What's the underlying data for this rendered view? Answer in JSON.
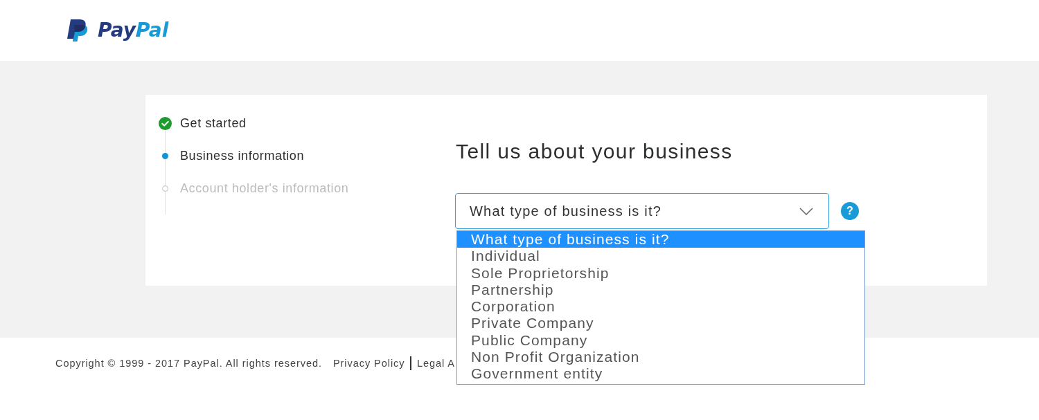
{
  "header": {
    "logo": {
      "text": "PayPal"
    }
  },
  "stepper": {
    "steps": [
      {
        "label": "Get started",
        "completed": true
      },
      {
        "label": "Business information",
        "completed": false
      },
      {
        "label": "Account holder's information",
        "completed": false
      }
    ]
  },
  "form": {
    "heading": "Tell us about your business",
    "business_type": {
      "value": "What type of business is it?",
      "expanded": true,
      "options": [
        {
          "label": "What type of business is it?",
          "selected": true
        },
        {
          "label": "Individual",
          "selected": false
        },
        {
          "label": "Sole Proprietorship",
          "selected": false
        },
        {
          "label": "Partnership",
          "selected": false
        },
        {
          "label": "Corporation",
          "selected": false
        },
        {
          "label": "Private Company",
          "selected": false
        },
        {
          "label": "Public Company",
          "selected": false
        },
        {
          "label": "Non Profit Organization",
          "selected": false
        },
        {
          "label": "Government entity",
          "selected": false
        }
      ]
    },
    "help": {
      "label": "?"
    }
  },
  "footer": {
    "copyright": "Copyright © 1999 - 2017 PayPal. All rights reserved.",
    "links": [
      "Privacy Policy",
      "Legal A"
    ]
  }
}
